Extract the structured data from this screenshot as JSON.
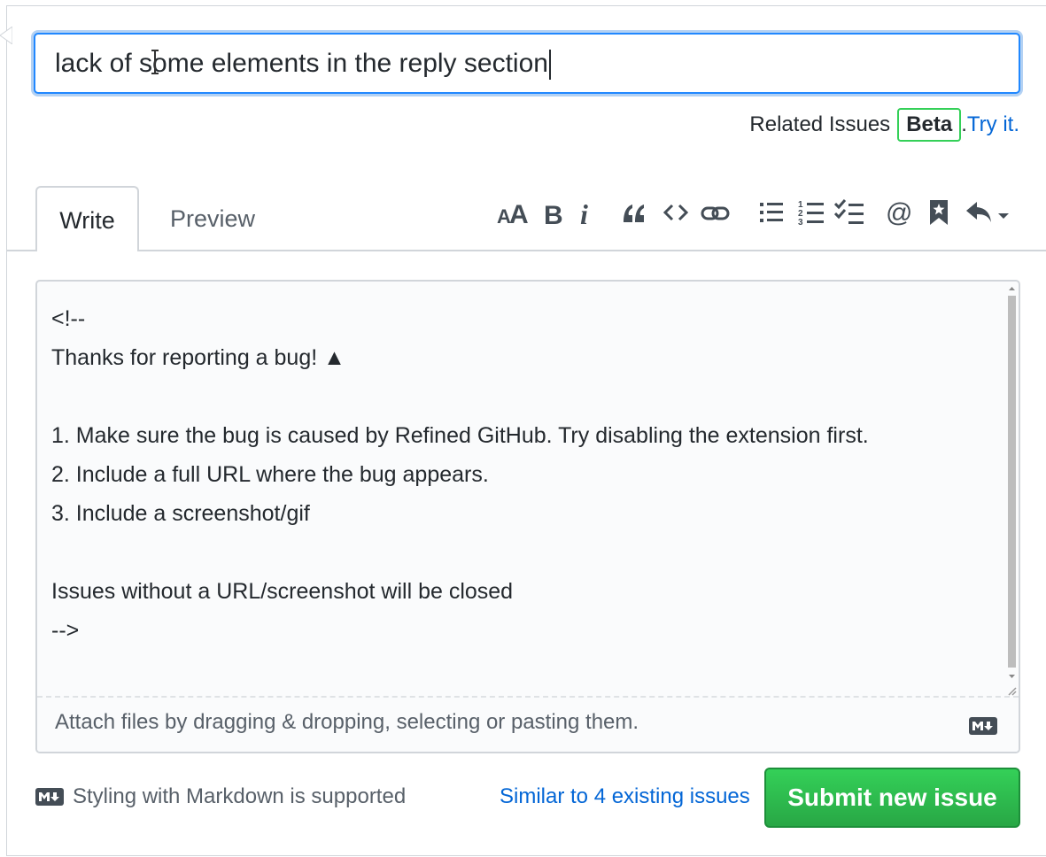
{
  "issue_title": {
    "value": "lack of some elements in the reply section"
  },
  "related_issues": {
    "label": "Related Issues",
    "badge": "Beta",
    "separator": ".",
    "link": "Try it."
  },
  "tabs": [
    {
      "label": "Write",
      "active": true
    },
    {
      "label": "Preview",
      "active": false
    }
  ],
  "toolbar": {
    "icons": [
      "text-size-icon",
      "bold-icon",
      "italic-icon",
      "quote-icon",
      "code-icon",
      "link-icon",
      "bulleted-list-icon",
      "numbered-list-icon",
      "task-list-icon",
      "mention-icon",
      "reference-icon",
      "saved-reply-icon"
    ]
  },
  "editor": {
    "lines": [
      "<!--",
      "Thanks for reporting a bug! ▲",
      "",
      "1. Make sure the bug is caused by Refined GitHub. Try disabling the extension first.",
      "2. Include a full URL where the bug appears.",
      "3. Include a screenshot/gif",
      "",
      "Issues without a URL/screenshot will be closed",
      "-->"
    ],
    "attach_hint": "Attach files by dragging & dropping, selecting or pasting them."
  },
  "footer": {
    "markdown_note": "Styling with Markdown is supported",
    "similar_link": "Similar to 4 existing issues",
    "submit_label": "Submit new issue"
  },
  "colors": {
    "accent_blue": "#0366d6",
    "focus_border": "#2188ff",
    "submit_green": "#28a745",
    "beta_border": "#34d058"
  }
}
